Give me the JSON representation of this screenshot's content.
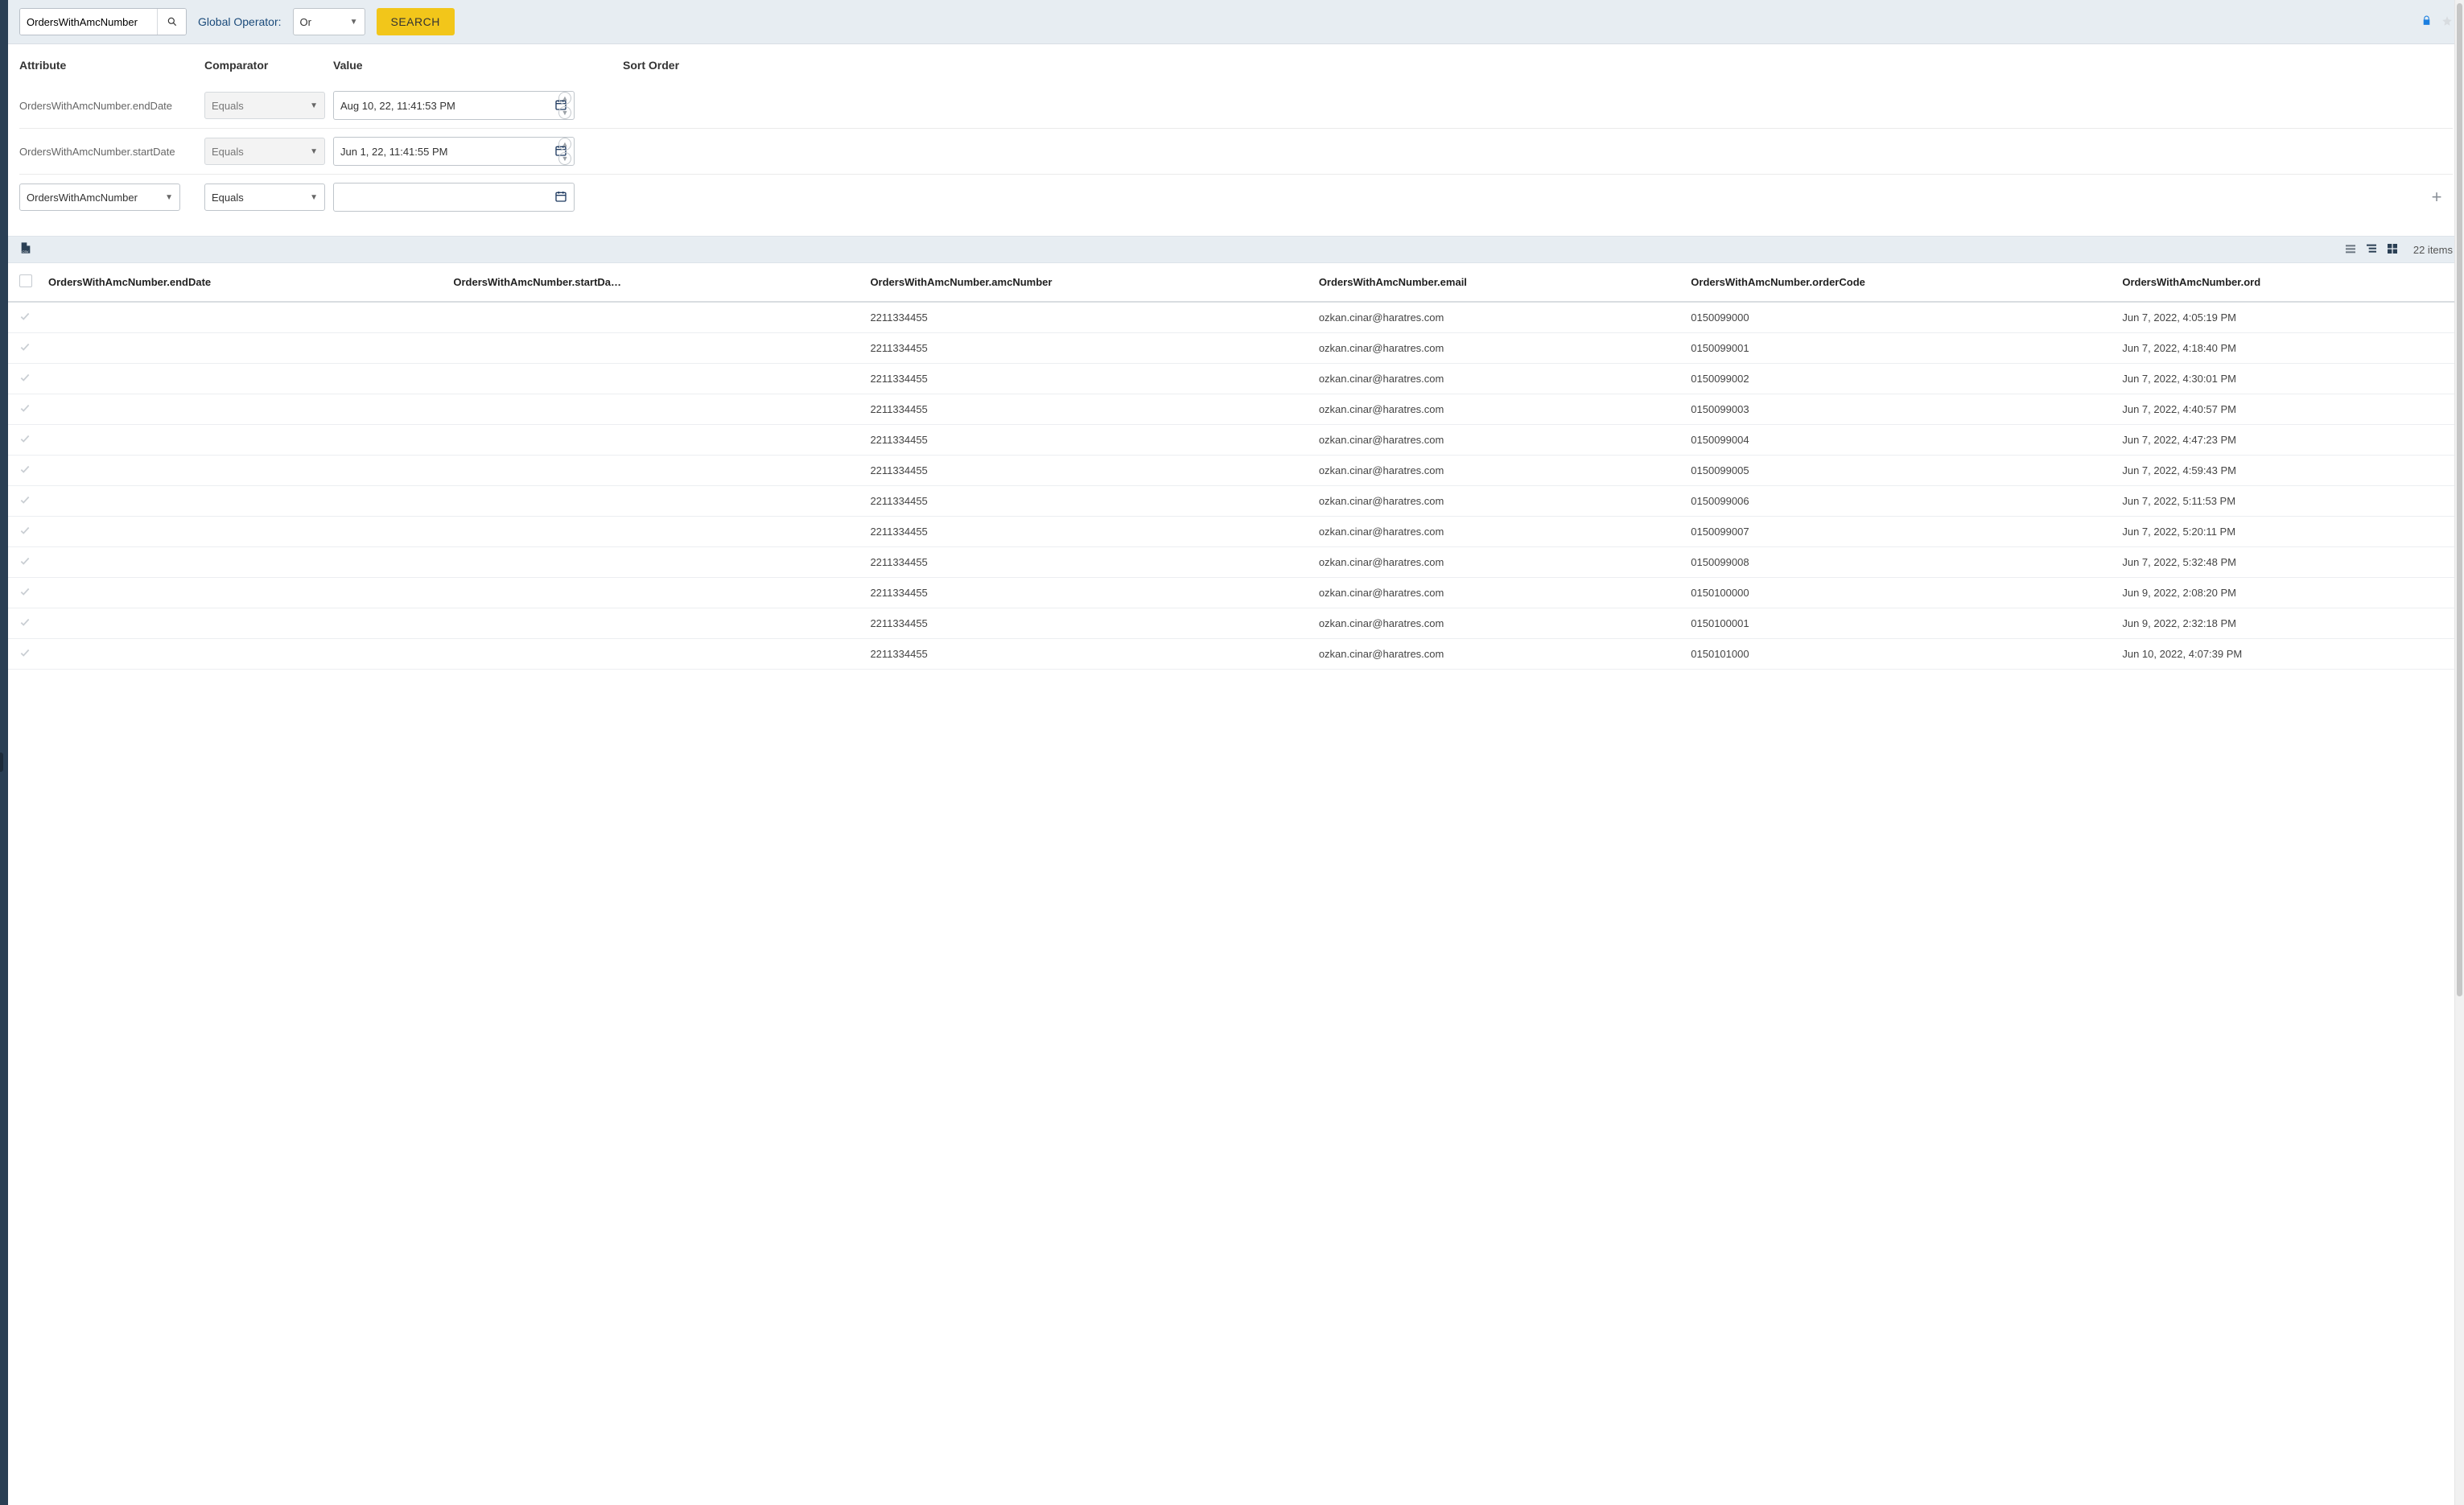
{
  "toolbar": {
    "search_value": "OrdersWithAmcNumber",
    "global_operator_label": "Global Operator:",
    "global_operator_value": "Or",
    "search_button_label": "SEARCH"
  },
  "filters": {
    "headers": {
      "attribute": "Attribute",
      "comparator": "Comparator",
      "value": "Value",
      "sort_order": "Sort Order"
    },
    "rows": [
      {
        "attribute": "OrdersWithAmcNumber.endDate",
        "comparator": "Equals",
        "value": "Aug 10, 22, 11:41:53 PM"
      },
      {
        "attribute": "OrdersWithAmcNumber.startDate",
        "comparator": "Equals",
        "value": "Jun 1, 22, 11:41:55 PM"
      }
    ],
    "new_row": {
      "attribute": "OrdersWithAmcNumber",
      "comparator": "Equals",
      "value": ""
    }
  },
  "results": {
    "item_count_label": "22 items",
    "columns": [
      "OrdersWithAmcNumber.endDate",
      "OrdersWithAmcNumber.startDa…",
      "OrdersWithAmcNumber.amcNumber",
      "OrdersWithAmcNumber.email",
      "OrdersWithAmcNumber.orderCode",
      "OrdersWithAmcNumber.ord"
    ],
    "rows": [
      {
        "endDate": "",
        "startDate": "",
        "amcNumber": "2211334455",
        "email": "ozkan.cinar@haratres.com",
        "orderCode": "0150099000",
        "orderDate": "Jun 7, 2022, 4:05:19 PM"
      },
      {
        "endDate": "",
        "startDate": "",
        "amcNumber": "2211334455",
        "email": "ozkan.cinar@haratres.com",
        "orderCode": "0150099001",
        "orderDate": "Jun 7, 2022, 4:18:40 PM"
      },
      {
        "endDate": "",
        "startDate": "",
        "amcNumber": "2211334455",
        "email": "ozkan.cinar@haratres.com",
        "orderCode": "0150099002",
        "orderDate": "Jun 7, 2022, 4:30:01 PM"
      },
      {
        "endDate": "",
        "startDate": "",
        "amcNumber": "2211334455",
        "email": "ozkan.cinar@haratres.com",
        "orderCode": "0150099003",
        "orderDate": "Jun 7, 2022, 4:40:57 PM"
      },
      {
        "endDate": "",
        "startDate": "",
        "amcNumber": "2211334455",
        "email": "ozkan.cinar@haratres.com",
        "orderCode": "0150099004",
        "orderDate": "Jun 7, 2022, 4:47:23 PM"
      },
      {
        "endDate": "",
        "startDate": "",
        "amcNumber": "2211334455",
        "email": "ozkan.cinar@haratres.com",
        "orderCode": "0150099005",
        "orderDate": "Jun 7, 2022, 4:59:43 PM"
      },
      {
        "endDate": "",
        "startDate": "",
        "amcNumber": "2211334455",
        "email": "ozkan.cinar@haratres.com",
        "orderCode": "0150099006",
        "orderDate": "Jun 7, 2022, 5:11:53 PM"
      },
      {
        "endDate": "",
        "startDate": "",
        "amcNumber": "2211334455",
        "email": "ozkan.cinar@haratres.com",
        "orderCode": "0150099007",
        "orderDate": "Jun 7, 2022, 5:20:11 PM"
      },
      {
        "endDate": "",
        "startDate": "",
        "amcNumber": "2211334455",
        "email": "ozkan.cinar@haratres.com",
        "orderCode": "0150099008",
        "orderDate": "Jun 7, 2022, 5:32:48 PM"
      },
      {
        "endDate": "",
        "startDate": "",
        "amcNumber": "2211334455",
        "email": "ozkan.cinar@haratres.com",
        "orderCode": "0150100000",
        "orderDate": "Jun 9, 2022, 2:08:20 PM"
      },
      {
        "endDate": "",
        "startDate": "",
        "amcNumber": "2211334455",
        "email": "ozkan.cinar@haratres.com",
        "orderCode": "0150100001",
        "orderDate": "Jun 9, 2022, 2:32:18 PM"
      },
      {
        "endDate": "",
        "startDate": "",
        "amcNumber": "2211334455",
        "email": "ozkan.cinar@haratres.com",
        "orderCode": "0150101000",
        "orderDate": "Jun 10, 2022, 4:07:39 PM"
      }
    ]
  }
}
